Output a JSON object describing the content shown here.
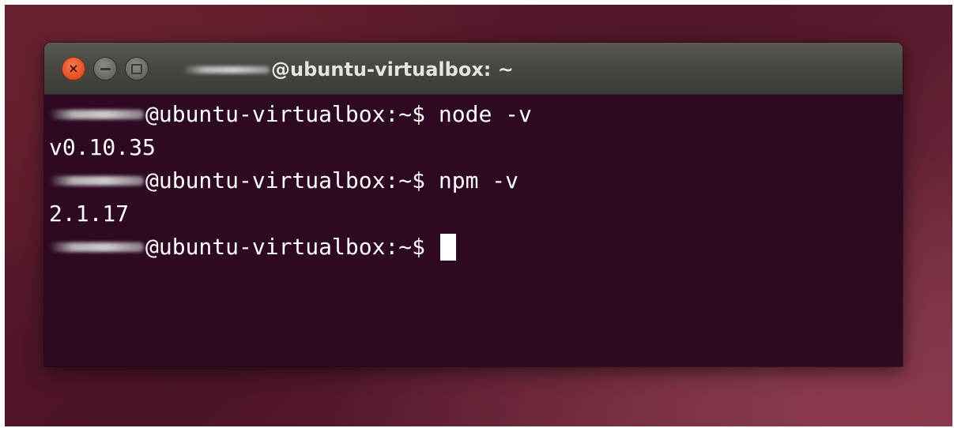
{
  "window": {
    "title_suffix": "@ubuntu-virtualbox: ~",
    "buttons": {
      "close": "close-icon",
      "minimize": "minimize-icon",
      "maximize": "maximize-icon"
    }
  },
  "terminal": {
    "prompt": "@ubuntu-virtualbox:~$ ",
    "commands": [
      {
        "command": "node -v",
        "output": "v0.10.35"
      },
      {
        "command": "npm -v",
        "output": "2.1.17"
      }
    ],
    "final_command": ""
  },
  "colors": {
    "terminal_background": "#2d0922",
    "terminal_text": "#ffffff",
    "titlebar": "#4a4843",
    "close_button": "#e8562a",
    "desktop_background": "#5b1a29"
  }
}
